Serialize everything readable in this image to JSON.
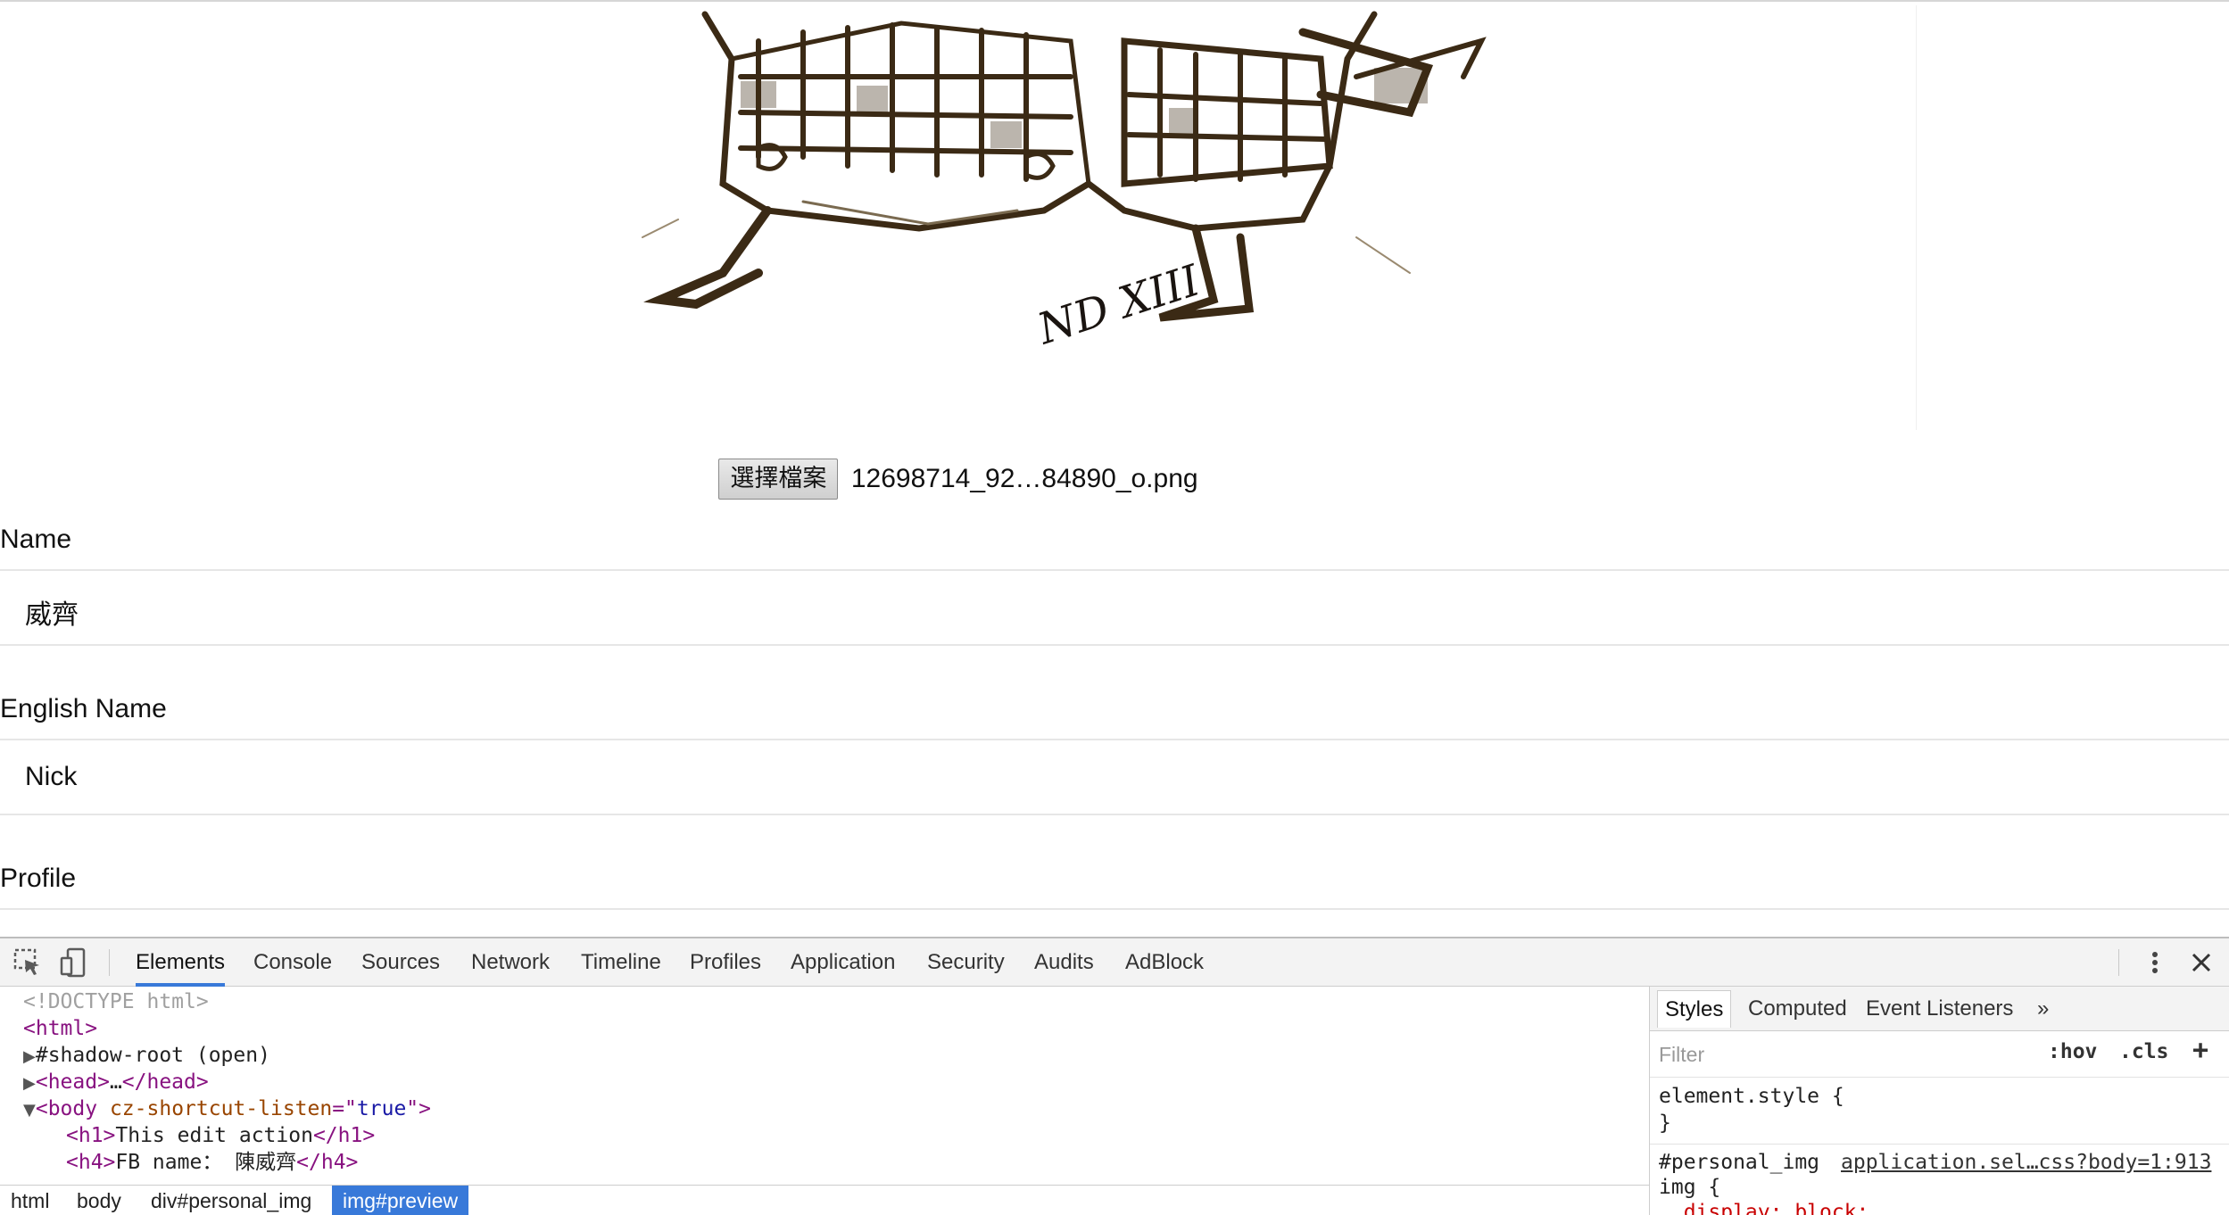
{
  "page": {
    "file_button": "選擇檔案",
    "file_name": "12698714_92…84890_o.png",
    "fields": [
      {
        "label": "Name",
        "value": "威齊"
      },
      {
        "label": "English Name",
        "value": "Nick"
      },
      {
        "label": "Profile",
        "value": ""
      }
    ],
    "preview_signature": "ND XIII"
  },
  "devtools": {
    "tabs": [
      "Elements",
      "Console",
      "Sources",
      "Network",
      "Timeline",
      "Profiles",
      "Application",
      "Security",
      "Audits",
      "AdBlock"
    ],
    "active_tab": "Elements",
    "dom": {
      "doctype": "<!DOCTYPE html>",
      "html_tag": "<html>",
      "shadow_root": "#shadow-root (open)",
      "head_open": "<head>",
      "head_ellipsis": "…",
      "head_close": "</head>",
      "body_open": "<body",
      "body_attr": "cz-shortcut-listen",
      "body_attr_eq": "=\"",
      "body_attr_value": "true",
      "body_close_bracket": "\">",
      "h1_open": "<h1>",
      "h1_text": "This edit action",
      "h1_close": "</h1>",
      "h4_open": "<h4>",
      "h4_text": "FB name： 陳威齊",
      "h4_close": "</h4>"
    },
    "breadcrumbs": [
      "html",
      "body",
      "div#personal_img",
      "img#preview"
    ],
    "styles": {
      "tabs": [
        "Styles",
        "Computed",
        "Event Listeners"
      ],
      "more": "»",
      "filter_placeholder": "Filter",
      "hov": ":hov",
      "cls": ".cls",
      "add": "+",
      "element_style_open": "element.style {",
      "element_style_close": "}",
      "rule_selector": "#personal_img",
      "rule_source": "application.sel…css?body=1:913",
      "rule_selector2": "img {",
      "rule_prop": "  display: block;"
    }
  },
  "colors": {
    "accent": "#3879d9",
    "tag": "#881280",
    "attr": "#994500",
    "attr_value": "#1a1aa6"
  }
}
